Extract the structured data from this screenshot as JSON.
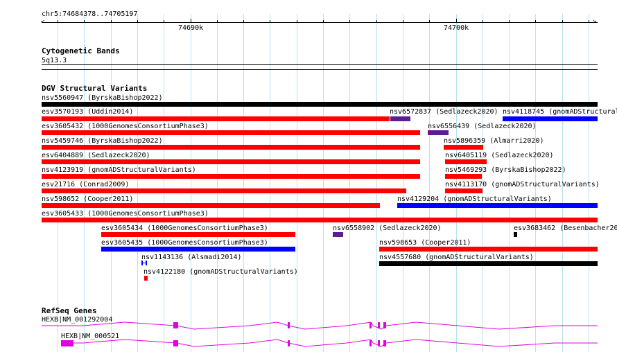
{
  "ruler": {
    "position": "chr5:74684378..74705197",
    "ticks": [
      "74690k",
      "74700k"
    ]
  },
  "cytoband": {
    "title": "Cytogenetic Bands",
    "band": "5q13.3"
  },
  "dgv": {
    "title": "DGV Structural Variants",
    "features": [
      {
        "label": "nsv5560947 (ByrskaBishop2022)",
        "color": "#000000"
      },
      {
        "label": "esv3570193 (Uddin2014)",
        "color": "#ff0000"
      },
      {
        "label": "nsv6572837 (Sedlazeck2020)",
        "color": "#5c1e8c"
      },
      {
        "label": "nsv4118745 (gnomADStructural",
        "color": "#0000ff"
      },
      {
        "label": "esv3605432 (1000GenomesConsortiumPhase3)",
        "color": "#ff0000"
      },
      {
        "label": "nsv6556439 (Sedlazeck2020)",
        "color": "#5c1e8c"
      },
      {
        "label": "nsv5459746 (ByrskaBishop2022)",
        "color": "#ff0000"
      },
      {
        "label": "nsv5896359 (Almarri2020)",
        "color": "#ff0000"
      },
      {
        "label": "esv6404889 (Sedlazeck2020)",
        "color": "#ff0000"
      },
      {
        "label": "nsv6405119 (Sedlazeck2020)",
        "color": "#ff0000"
      },
      {
        "label": "nsv4123919 (gnomADStructuralVariants)",
        "color": "#ff0000"
      },
      {
        "label": "nsv5469293 (ByrskaBishop2022)",
        "color": "#ff0000"
      },
      {
        "label": "esv21716 (Conrad2009)",
        "color": "#ff0000"
      },
      {
        "label": "nsv4113170 (gnomADStructuralVariants)",
        "color": "#ff0000"
      },
      {
        "label": "nsv598652 (Cooper2011)",
        "color": "#ff0000"
      },
      {
        "label": "nsv4129204 (gnomADStructuralVariants)",
        "color": "#0000ff"
      },
      {
        "label": "esv3605433 (1000GenomesConsortiumPhase3)",
        "color": "#ff0000"
      },
      {
        "label": "esv3605434 (1000GenomesConsortiumPhase3)",
        "color": "#ff0000"
      },
      {
        "label": "nsv6558902 (Sedlazeck2020)",
        "color": "#5c1e8c"
      },
      {
        "label": "esv3683462 (Besenbacher20",
        "color": "#000000"
      },
      {
        "label": "esv3605435 (1000GenomesConsortiumPhase3)",
        "color": "#0000ff"
      },
      {
        "label": "nsv598653 (Cooper2011)",
        "color": "#ff0000"
      },
      {
        "label": "nsv1143136 (Alsmadi2014)",
        "color": "#0000ff"
      },
      {
        "label": "nsv4557680 (gnomADStructuralVariants)",
        "color": "#000000"
      },
      {
        "label": "nsv4122180 (gnomADStructuralVariants)",
        "color": "#ff0000"
      }
    ]
  },
  "refseq": {
    "title": "RefSeq Genes",
    "transcripts": [
      {
        "label": "HEXB|NM_001292004",
        "color": "#e100e1"
      },
      {
        "label": "HEXB|NM_000521",
        "color": "#e100e1"
      }
    ]
  }
}
